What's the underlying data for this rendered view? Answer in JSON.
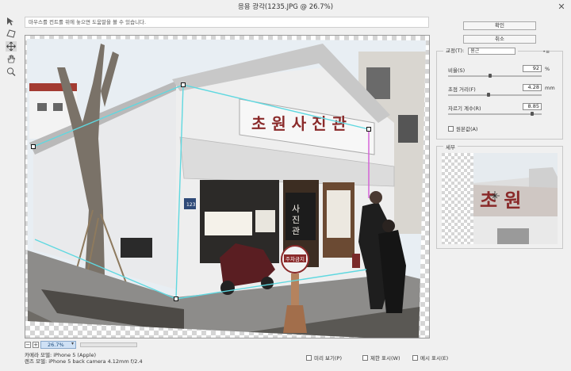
{
  "window": {
    "title": "응용 광각(1235.JPG @ 26.7%)",
    "close_glyph": "✕"
  },
  "tools": [
    {
      "name": "constraint-tool"
    },
    {
      "name": "polygon-constraint-tool"
    },
    {
      "name": "move-tool"
    },
    {
      "name": "hand-tool"
    },
    {
      "name": "zoom-tool"
    }
  ],
  "hint": "마우스를 컨트롤 위에 놓으면 도움말을 볼 수 있습니다.",
  "buttons": {
    "ok": "확인",
    "cancel": "취소"
  },
  "correction": {
    "label": "교정(T):",
    "value": "원근",
    "rows": [
      {
        "label": "비율(S)",
        "value": "92",
        "unit": "%",
        "slider": 0.45
      },
      {
        "label": "초점 거리(F)",
        "value": "4.28",
        "unit": "mm",
        "slider": 0.43
      },
      {
        "label": "자르기 계수(R)",
        "value": "8.85",
        "unit": "",
        "slider": 0.9
      }
    ],
    "as_shot_label": "원본값(A)"
  },
  "detail": {
    "label": "세부"
  },
  "zoom": {
    "value": "26.7%",
    "minus": "−",
    "plus": "+"
  },
  "camera": {
    "model": "카메라 모델: iPhone 5 (Apple)",
    "lens": "렌즈 모델: iPhone 5 back camera 4.12mm f/2.4"
  },
  "options": [
    {
      "label": "미리 보기(P)"
    },
    {
      "label": "제한 표시(W)"
    },
    {
      "label": "메시 표시(E)"
    }
  ],
  "photo": {
    "sign_text": "초 원 사 진 관",
    "vertical_sign": "사진관",
    "round_sign": "주차금지",
    "house_number": "123"
  },
  "colors": {
    "guide_cyan": "#5fd8e0",
    "guide_magenta": "#d35ad6",
    "sign_red": "#8a2a2a",
    "zoom_field": "#cfe1f5"
  }
}
